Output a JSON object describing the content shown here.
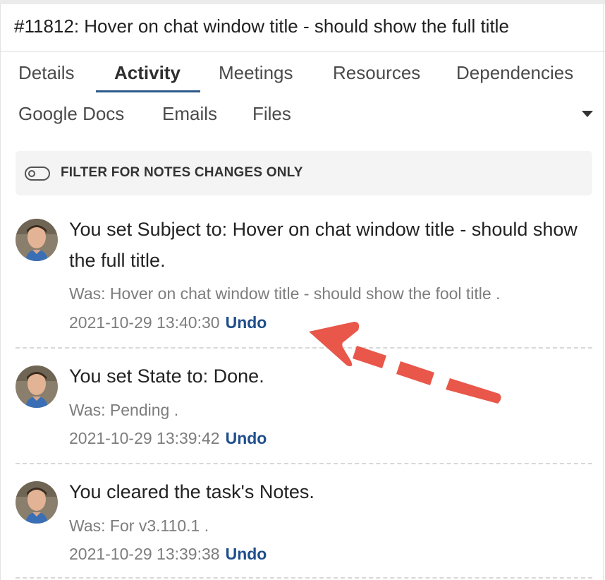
{
  "task": {
    "title": "#11812: Hover on chat window title - should show the full title"
  },
  "tabs": [
    {
      "label": "Details",
      "active": false
    },
    {
      "label": "Activity",
      "active": true
    },
    {
      "label": "Meetings",
      "active": false
    },
    {
      "label": "Resources",
      "active": false
    },
    {
      "label": "Dependencies",
      "active": false
    },
    {
      "label": "Google Docs",
      "active": false
    },
    {
      "label": "Emails",
      "active": false
    },
    {
      "label": "Files",
      "active": false
    }
  ],
  "filter": {
    "label": "FILTER FOR NOTES CHANGES ONLY",
    "enabled": false
  },
  "activity": [
    {
      "text": "You set Subject to: Hover on chat window title - should show the full title.",
      "was": "Was: Hover on chat window title - should show the fool title .",
      "timestamp": "2021-10-29 13:40:30",
      "undo_label": "Undo"
    },
    {
      "text": "You set State to: Done.",
      "was": "Was: Pending .",
      "timestamp": "2021-10-29 13:39:42",
      "undo_label": "Undo"
    },
    {
      "text": "You cleared the task's Notes.",
      "was": "Was: For v3.110.1 .",
      "timestamp": "2021-10-29 13:39:38",
      "undo_label": "Undo"
    }
  ],
  "icons": {
    "overflow": "caret-down-icon",
    "annotation": "red-dashed-arrow"
  },
  "colors": {
    "accent": "#2c5a8a",
    "undo": "#1f4e8c",
    "annotation_arrow": "#e8574a"
  }
}
